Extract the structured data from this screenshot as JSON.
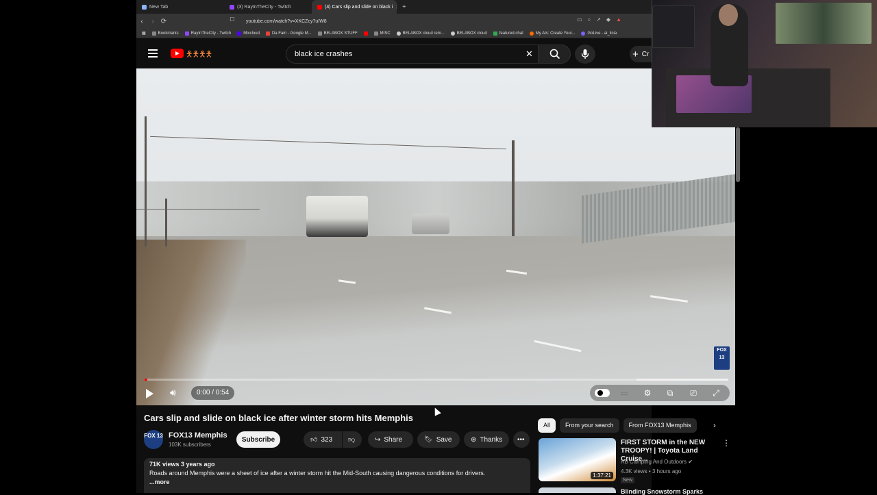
{
  "browser": {
    "tabs": [
      {
        "label": "New Tab",
        "favicon_color": "#8ab4f8",
        "active": false
      },
      {
        "label": "(3) RayInTheCity - Twitch",
        "favicon_color": "#9146ff",
        "active": false
      },
      {
        "label": "(4) Cars slip and slide on black i",
        "favicon_color": "#ff0000",
        "active": true
      }
    ],
    "new_tab_glyph": "+",
    "url": "youtube.com/watch?v=XKCZcy7uIW8",
    "bookmarks": [
      {
        "label": "Bookmarks",
        "color": "#888888"
      },
      {
        "label": "RayInTheCity - Twitch",
        "color": "#9146ff"
      },
      {
        "label": "Mixcloud",
        "color": "#5000ff"
      },
      {
        "label": "Da Fam - Google M...",
        "color": "#ea4335"
      },
      {
        "label": "BELABOX STUFF",
        "color": "#888888"
      },
      {
        "label": "",
        "color": "#ff0000"
      },
      {
        "label": "MISC",
        "color": "#888888"
      },
      {
        "label": "BELABOX cloud rem...",
        "color": "#cccccc"
      },
      {
        "label": "BELABOX cloud",
        "color": "#cccccc"
      },
      {
        "label": "featured.chat",
        "color": "#34a853"
      },
      {
        "label": "My AIs: Create Your...",
        "color": "#ff6a00"
      },
      {
        "label": "GoLive - ai_licia",
        "color": "#7b61ff"
      }
    ]
  },
  "youtube": {
    "search_value": "black ice crashes",
    "create_label": "Cr",
    "video": {
      "time": "0:00 / 0:54",
      "progress": 0.0,
      "watermark": "FOX 13"
    },
    "title": "Cars slip and slide on black ice after winter storm hits Memphis",
    "channel": {
      "avatar_text": "FOX 13",
      "name": "FOX13 Memphis",
      "subscribers": "103K subscribers"
    },
    "subscribe_label": "Subscribe",
    "actions": {
      "likes": "323",
      "share": "Share",
      "save": "Save",
      "thanks": "Thanks"
    },
    "description": {
      "meta": "71K views  3 years ago",
      "text": "Roads around Memphis were a sheet of ice after a winter storm hit the Mid-South causing dangerous conditions for drivers.",
      "more": "...more"
    },
    "chips": [
      "All",
      "From your search",
      "From FOX13 Memphis"
    ],
    "recommendations": [
      {
        "title": "FIRST STORM in the NEW TROOPY! | Toyota Land Cruise...",
        "channel": "AB Camping And Outdoors",
        "meta": "4.3K views • 3 hours ago",
        "badge": "New",
        "duration": "1:37:21"
      },
      {
        "title": "Blinding Snowstorm Sparks"
      }
    ]
  }
}
